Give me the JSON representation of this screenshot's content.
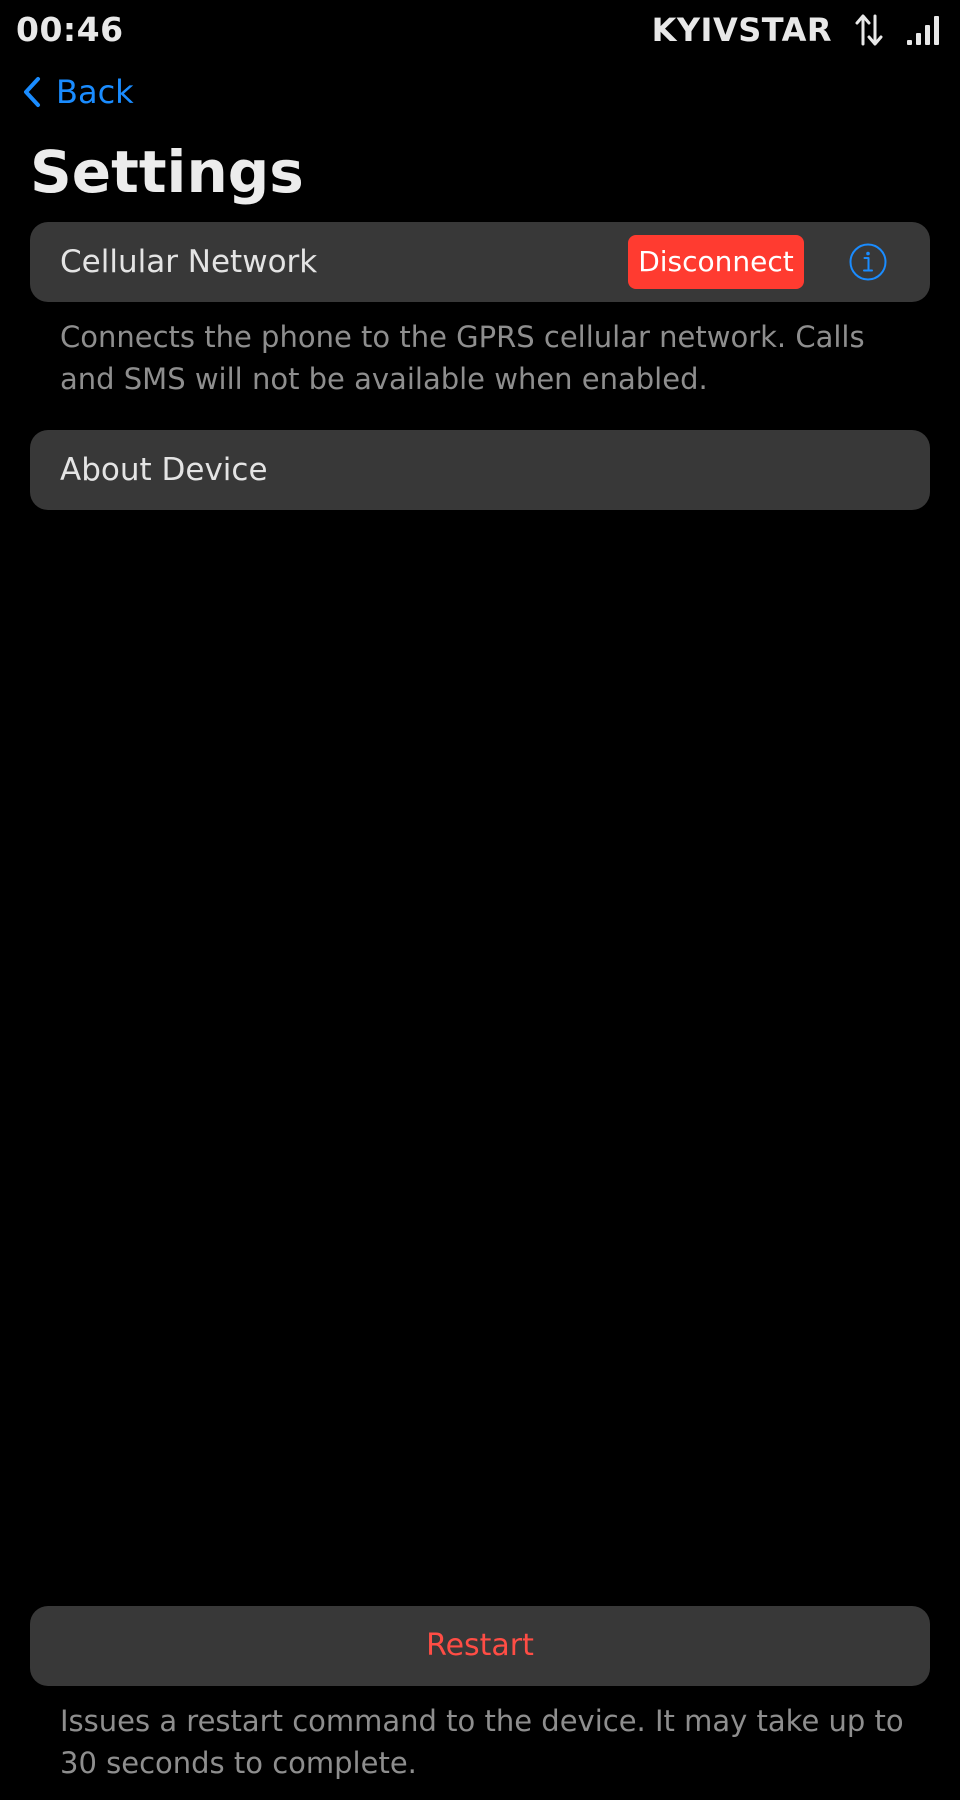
{
  "status_bar": {
    "time": "00:46",
    "carrier": "KYIVSTAR",
    "data_icon": "data-transfer-arrows-icon",
    "signal_icon": "cellular-signal-icon"
  },
  "nav": {
    "back_label": "Back",
    "back_icon": "chevron-left-icon"
  },
  "page": {
    "title": "Settings"
  },
  "cellular": {
    "label": "Cellular Network",
    "disconnect_label": "Disconnect",
    "info_icon": "info-circle-icon",
    "footnote": "Connects the phone to the GPRS cellular network. Calls and SMS will not be available when enabled."
  },
  "about": {
    "label": "About Device"
  },
  "restart": {
    "label": "Restart",
    "footnote": "Issues a restart command to the device. It may take up to 30 seconds to complete."
  },
  "colors": {
    "background": "#000000",
    "card": "#383838",
    "accent_blue": "#1a8cff",
    "destructive_red": "#ff3b30",
    "restart_text": "#ff4d45",
    "footnote_text": "#8e8e8e"
  }
}
